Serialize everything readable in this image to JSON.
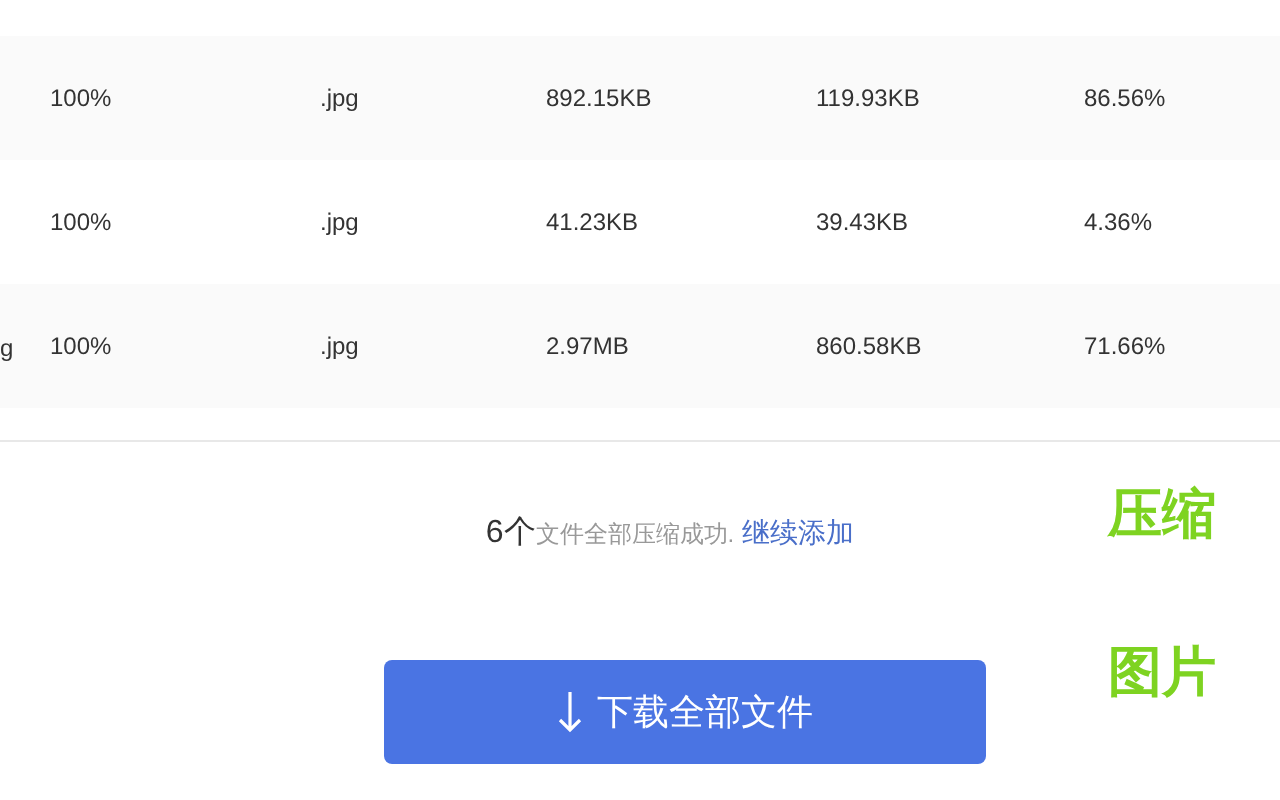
{
  "table": {
    "rows": [
      {
        "column_1": null,
        "quality": "100%",
        "format": ".jpg",
        "original_size": "892.15KB",
        "compressed_size": "119.93KB",
        "saving": "86.56%"
      },
      {
        "column_1": null,
        "quality": "100%",
        "format": ".jpg",
        "original_size": "41.23KB",
        "compressed_size": "39.43KB",
        "saving": "4.36%"
      },
      {
        "column_1": "g",
        "quality": "100%",
        "format": ".jpg",
        "original_size": "2.97MB",
        "compressed_size": "860.58KB",
        "saving": "71.66%"
      }
    ]
  },
  "status": {
    "count": "6个",
    "message": "文件全部压缩成功.",
    "link": "继续添加"
  },
  "download_button": {
    "label": "下载全部文件"
  },
  "side_labels": [
    "压缩",
    "图片"
  ]
}
